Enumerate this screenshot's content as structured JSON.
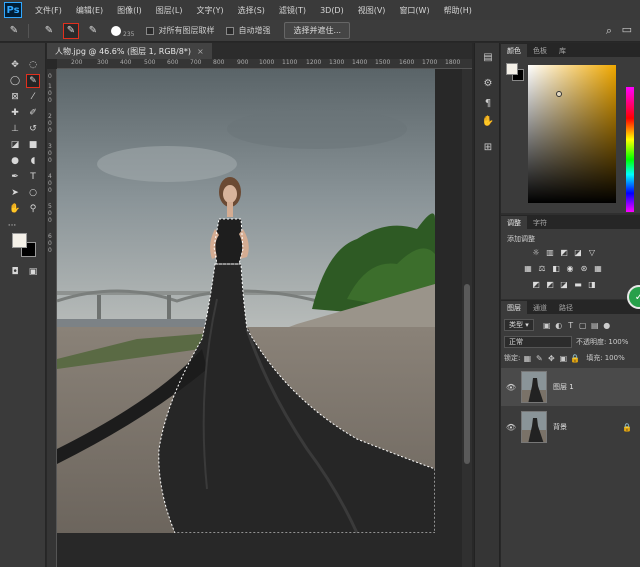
{
  "app": {
    "logo": "Ps"
  },
  "menu": [
    "文件(F)",
    "编辑(E)",
    "图像(I)",
    "图层(L)",
    "文字(Y)",
    "选择(S)",
    "滤镜(T)",
    "3D(D)",
    "视图(V)",
    "窗口(W)",
    "帮助(H)"
  ],
  "options": {
    "brush_size": "235",
    "sample_all_label": "对所有图层取样",
    "auto_enhance_label": "自动增强",
    "select_mask_button": "选择并遮住..."
  },
  "document": {
    "tab_title": "人物.jpg @ 46.6% (图层 1, RGB/8*)",
    "tab_close": "×"
  },
  "ruler": {
    "h_ticks": [
      "200",
      "300",
      "400",
      "500",
      "600",
      "700",
      "800",
      "900",
      "1000",
      "1100",
      "1200",
      "1300",
      "1400",
      "1500",
      "1600",
      "1700",
      "1800"
    ],
    "v_ticks": [
      "0",
      "1",
      "0",
      "0",
      "2",
      "0",
      "0",
      "3",
      "0",
      "0",
      "4",
      "0",
      "0",
      "5",
      "0",
      "0",
      "6",
      "0",
      "0"
    ]
  },
  "panels": {
    "color_tabs": [
      "颜色",
      "色板",
      "库"
    ],
    "adjust_tabs": [
      "调整",
      "字符"
    ],
    "adjust_title": "添加调整",
    "layers_tabs": [
      "图层",
      "通道",
      "路径"
    ],
    "filter_kind": "类型",
    "blend_mode": "正常",
    "opacity_label": "不透明度:",
    "opacity_value": "100%",
    "lock_label": "锁定:",
    "fill_label": "填充:",
    "fill_value": "100%",
    "layers": [
      {
        "name": "图层 1",
        "selected": true
      },
      {
        "name": "背景",
        "selected": false
      }
    ]
  },
  "colors": {
    "foreground": "#f4f0e8",
    "background": "#000000",
    "selection_highlight": "#e0301e"
  }
}
